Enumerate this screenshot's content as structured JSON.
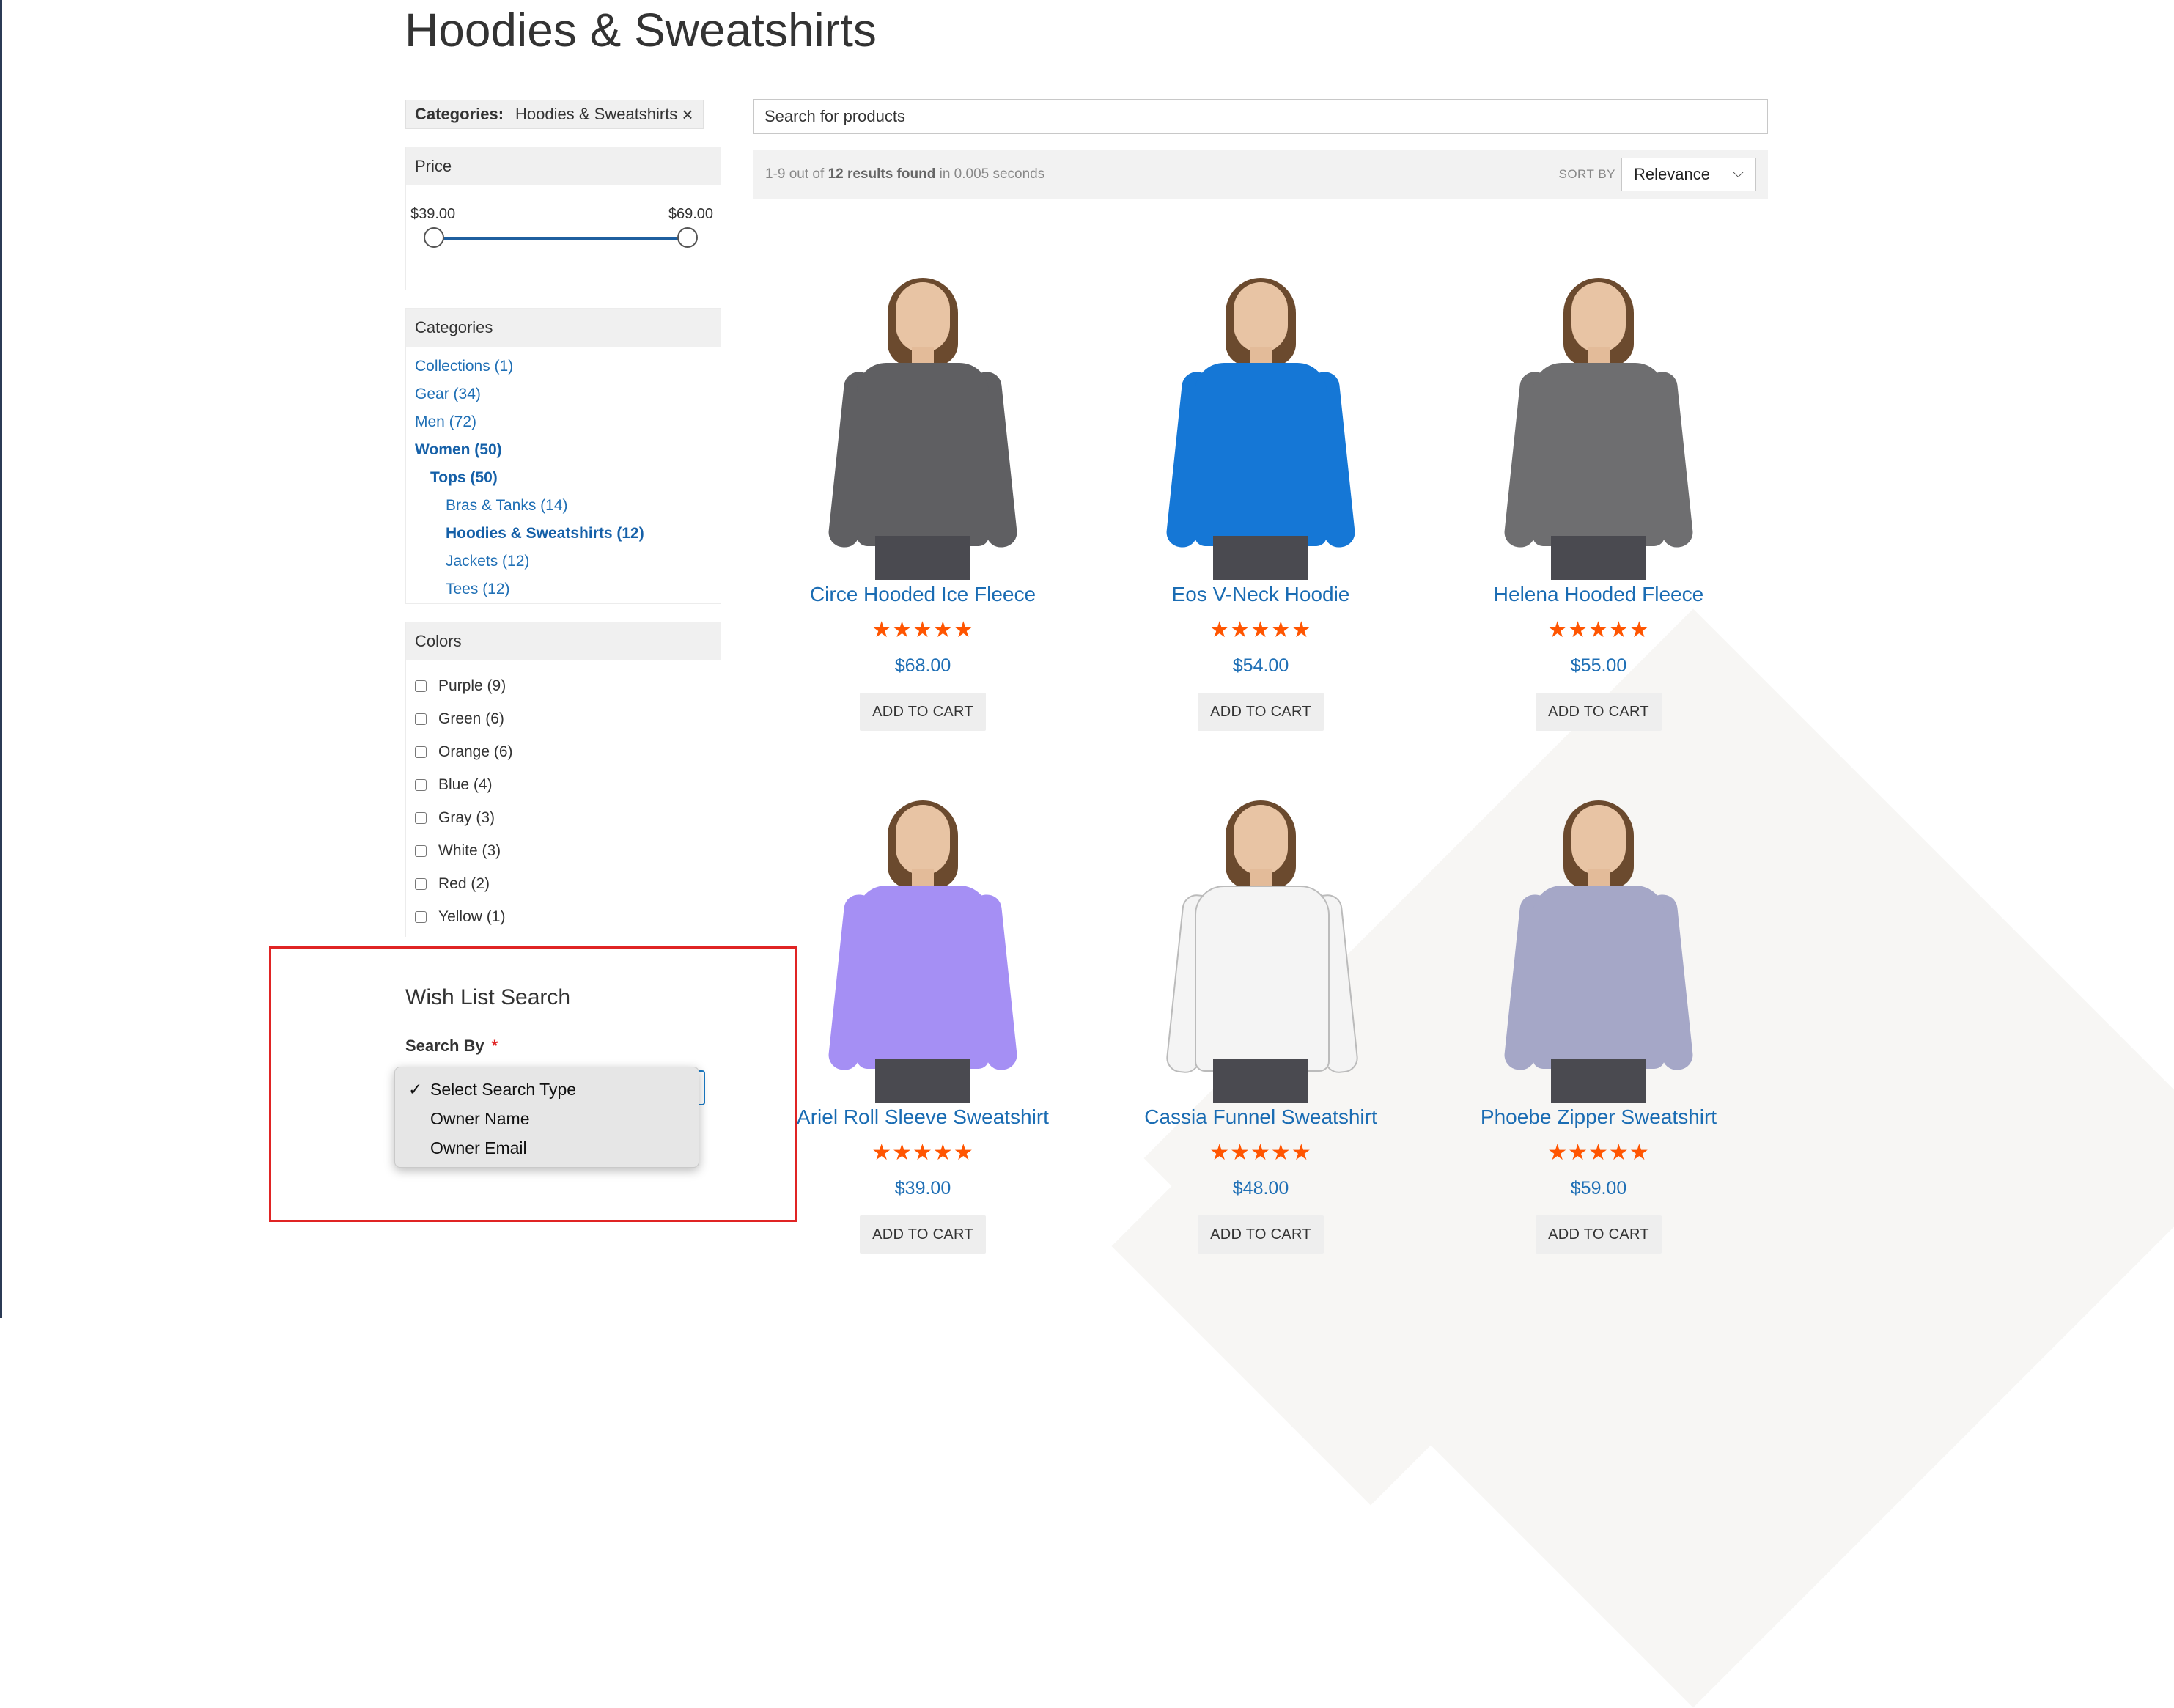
{
  "page_title": "Hoodies & Sweatshirts",
  "filter": {
    "label": "Categories:",
    "value": "Hoodies & Sweatshirts"
  },
  "price": {
    "heading": "Price",
    "min": "$39.00",
    "max": "$69.00"
  },
  "categories": {
    "heading": "Categories",
    "items": [
      {
        "label": "Collections (1)"
      },
      {
        "label": "Gear (34)"
      },
      {
        "label": "Men (72)"
      },
      {
        "label": "Women (50)"
      },
      {
        "label": "Tops (50)"
      },
      {
        "label": "Bras & Tanks (14)"
      },
      {
        "label": "Hoodies & Sweatshirts (12)"
      },
      {
        "label": "Jackets (12)"
      },
      {
        "label": "Tees (12)"
      }
    ]
  },
  "colors": {
    "heading": "Colors",
    "items": [
      {
        "label": "Purple (9)"
      },
      {
        "label": "Green (6)"
      },
      {
        "label": "Orange (6)"
      },
      {
        "label": "Blue (4)"
      },
      {
        "label": "Gray (3)"
      },
      {
        "label": "White (3)"
      },
      {
        "label": "Red (2)"
      },
      {
        "label": "Yellow (1)"
      }
    ]
  },
  "search": {
    "placeholder": "Search for products"
  },
  "toolbar": {
    "range": "1-9 out of ",
    "count": "12 results found",
    "time": " in 0.005 seconds",
    "sort_label": "SORT BY",
    "sort_value": "Relevance"
  },
  "products": [
    {
      "name": "Circe Hooded Ice Fleece",
      "stars": "★★★★★",
      "price": "$68.00",
      "cta": "ADD TO CART",
      "color": "#5f5f62"
    },
    {
      "name": "Eos V-Neck Hoodie",
      "stars": "★★★★★",
      "price": "$54.00",
      "cta": "ADD TO CART",
      "color": "#1577d6"
    },
    {
      "name": "Helena Hooded Fleece",
      "stars": "★★★★★",
      "price": "$55.00",
      "cta": "ADD TO CART",
      "color": "#6e6e70"
    },
    {
      "name": "Ariel Roll Sleeve Sweatshirt",
      "stars": "★★★★★",
      "price": "$39.00",
      "cta": "ADD TO CART",
      "color": "#a58ff4"
    },
    {
      "name": "Cassia Funnel Sweatshirt",
      "stars": "★★★★★",
      "price": "$48.00",
      "cta": "ADD TO CART",
      "color": "#f4f4f4"
    },
    {
      "name": "Phoebe Zipper Sweatshirt",
      "stars": "★★★★★",
      "price": "$59.00",
      "cta": "ADD TO CART",
      "color": "#a5a7c7"
    }
  ],
  "wishlist": {
    "title": "Wish List Search",
    "search_by_label": "Search By",
    "required_mark": "*",
    "options": [
      {
        "label": "Select Search Type",
        "selected": true
      },
      {
        "label": "Owner Name",
        "selected": false
      },
      {
        "label": "Owner Email",
        "selected": false
      }
    ],
    "check_glyph": "✓"
  }
}
